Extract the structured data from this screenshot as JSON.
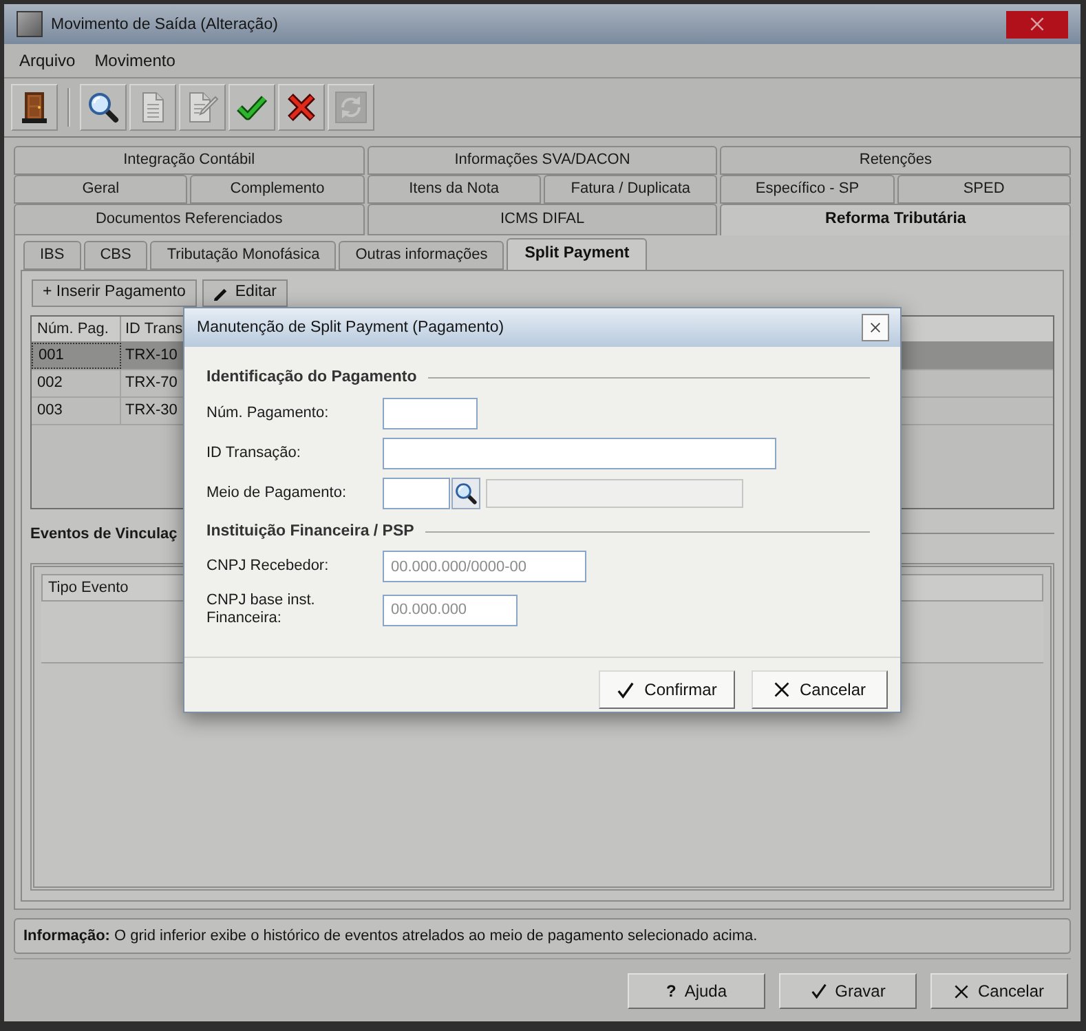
{
  "window": {
    "title": "Movimento de Saída (Alteração)"
  },
  "menu": [
    {
      "label": "Arquivo"
    },
    {
      "label": "Movimento"
    }
  ],
  "toolbar": [
    {
      "kind": "exit",
      "disabled": false
    },
    {
      "kind": "separator"
    },
    {
      "kind": "search",
      "disabled": false
    },
    {
      "kind": "new",
      "disabled": true
    },
    {
      "kind": "edit",
      "disabled": true
    },
    {
      "kind": "confirm",
      "disabled": false
    },
    {
      "kind": "cancel",
      "disabled": false
    },
    {
      "kind": "refresh",
      "disabled": true
    }
  ],
  "tab_rows": [
    [
      {
        "label": "Integração Contábil",
        "selected": false
      },
      {
        "label": "Informações SVA/DACON",
        "selected": false
      },
      {
        "label": "Retenções",
        "selected": false
      }
    ],
    [
      {
        "label": "Geral",
        "selected": false
      },
      {
        "label": "Complemento",
        "selected": false
      },
      {
        "label": "Itens da Nota",
        "selected": false
      },
      {
        "label": "Fatura / Duplicata",
        "selected": false
      },
      {
        "label": "Específico - SP",
        "selected": false
      },
      {
        "label": "SPED",
        "selected": false
      }
    ],
    [
      {
        "label": "Documentos Referenciados",
        "selected": false
      },
      {
        "label": "ICMS DIFAL",
        "selected": false
      },
      {
        "label": "Reforma Tributária",
        "selected": true
      }
    ]
  ],
  "subtabs": [
    {
      "label": "IBS",
      "selected": false
    },
    {
      "label": "CBS",
      "selected": false
    },
    {
      "label": "Tributação Monofásica",
      "selected": false
    },
    {
      "label": "Outras informações",
      "selected": false
    },
    {
      "label": "Split Payment",
      "selected": true
    }
  ],
  "split_payment": {
    "buttons": [
      {
        "kind": "add",
        "label": "+ Inserir Pagamento"
      },
      {
        "kind": "edit",
        "label": "Editar"
      }
    ],
    "grid": {
      "columns": [
        "Núm. Pag.",
        "ID Trans"
      ],
      "rows": [
        {
          "cells": [
            "001",
            "TRX-10"
          ],
          "selected": true
        },
        {
          "cells": [
            "002",
            "TRX-70"
          ],
          "selected": false
        },
        {
          "cells": [
            "003",
            "TRX-30"
          ],
          "selected": false
        }
      ]
    },
    "events": {
      "title": "Eventos de Vinculaç",
      "columns": [
        "Tipo Evento"
      ]
    }
  },
  "info": "**Informação:** O grid inferior exibe o histórico de eventos atrelados ao meio de pagamento selecionado acima.",
  "buttons": [
    {
      "kind": "help",
      "icon": "?",
      "label": "Ajuda"
    },
    {
      "kind": "save",
      "label": "Gravar"
    },
    {
      "kind": "cancel",
      "label": "Cancelar"
    }
  ],
  "dialog": {
    "title": "Manutenção de Split Payment (Pagamento)",
    "sections": [
      {
        "title": "Identificação do Pagamento",
        "fields": [
          {
            "kind": "number",
            "label": "Núm. Pagamento:"
          },
          {
            "kind": "text",
            "label": "ID Transação:"
          },
          {
            "kind": "lookup",
            "label": "Meio de Pagamento:",
            "description_disabled": true
          }
        ]
      },
      {
        "title": "Instituição Financeira / PSP",
        "fields": [
          {
            "kind": "cnpj",
            "label": "CNPJ Recebedor:",
            "placeholder": "00.000.000/0000-00"
          },
          {
            "kind": "cnpj_base",
            "label": "CNPJ base inst. Financeira:",
            "placeholder": "00.000.000"
          }
        ]
      }
    ],
    "buttons": [
      {
        "kind": "confirm",
        "label": "Confirmar"
      },
      {
        "kind": "cancel",
        "label": "Cancelar"
      }
    ]
  }
}
